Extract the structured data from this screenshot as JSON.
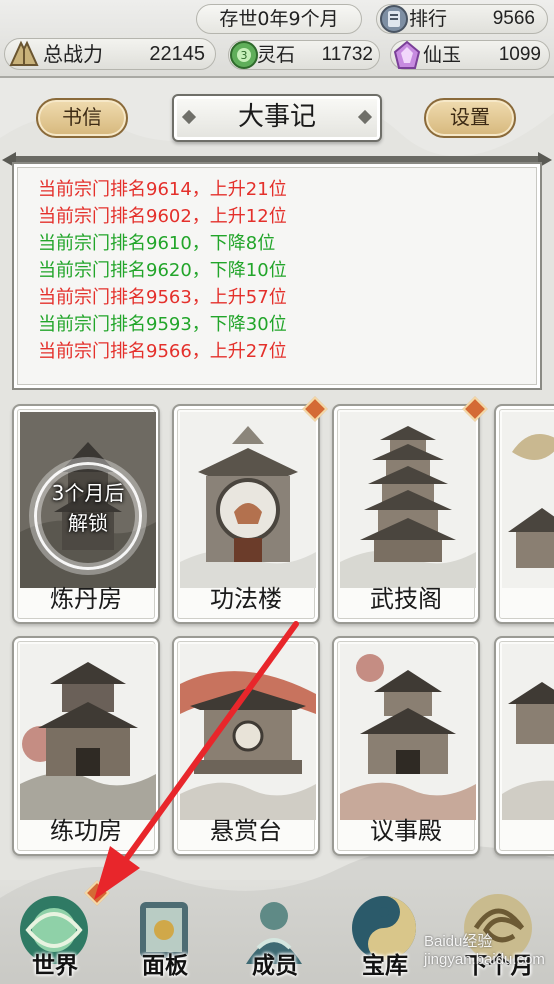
{
  "topbar": {
    "date": "存世0年9个月",
    "rank_label": "排行",
    "rank_value": "9566",
    "power_label": "总战力",
    "power_value": "22145",
    "stone_label": "灵石",
    "stone_value": "11732",
    "jade_label": "仙玉",
    "jade_value": "1099"
  },
  "header": {
    "letter_button": "书信",
    "title": "大事记",
    "settings_button": "设置"
  },
  "events": [
    {
      "text": "当前宗门排名9614，上升21位",
      "trend": "up"
    },
    {
      "text": "当前宗门排名9602，上升12位",
      "trend": "up"
    },
    {
      "text": "当前宗门排名9610，下降8位",
      "trend": "down"
    },
    {
      "text": "当前宗门排名9620，下降10位",
      "trend": "down"
    },
    {
      "text": "当前宗门排名9563，上升57位",
      "trend": "up"
    },
    {
      "text": "当前宗门排名9593，下降30位",
      "trend": "down"
    },
    {
      "text": "当前宗门排名9566，上升27位",
      "trend": "up"
    }
  ],
  "buildings": [
    {
      "name": "炼丹房",
      "locked": true,
      "lock_text": "3个月后\n解锁"
    },
    {
      "name": "功法楼",
      "badge": true
    },
    {
      "name": "武技阁",
      "badge": true
    },
    {
      "name": "练功房"
    },
    {
      "name": "悬赏台"
    },
    {
      "name": "议事殿"
    }
  ],
  "bottom_nav": [
    {
      "label": "世界",
      "icon": "world-icon",
      "badge": true
    },
    {
      "label": "面板",
      "icon": "scroll-icon"
    },
    {
      "label": "成员",
      "icon": "member-icon"
    },
    {
      "label": "宝库",
      "icon": "treasury-icon"
    },
    {
      "label": "下个月",
      "icon": "next-month-icon"
    }
  ],
  "watermark": "Baidu经验 jingyan.baidu.com",
  "colors": {
    "rank_up": "#e4302b",
    "rank_down": "#22a52a",
    "arrow": "#e8262b",
    "badge": "#d46a35"
  }
}
